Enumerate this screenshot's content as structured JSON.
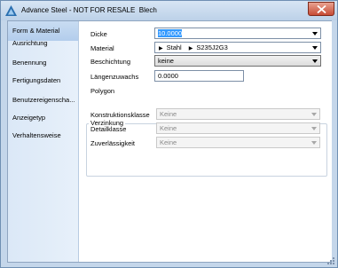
{
  "window": {
    "title": "Advance Steel - NOT FOR RESALE  Blech"
  },
  "sidebar": {
    "items": [
      {
        "label": "Form & Material"
      },
      {
        "label": "Ausrichtung"
      },
      {
        "label": "Benennung"
      },
      {
        "label": "Fertigungsdaten"
      },
      {
        "label": "Benutzereigenscha..."
      },
      {
        "label": "Anzeigetyp"
      },
      {
        "label": "Verhaltensweise"
      }
    ]
  },
  "form": {
    "dicke": {
      "label": "Dicke",
      "value": "10.0000"
    },
    "material": {
      "label": "Material",
      "group": "Stahl",
      "value": "S235J2G3"
    },
    "beschichtung": {
      "label": "Beschichtung",
      "value": "keine"
    },
    "laengenzuwachs": {
      "label": "Längenzuwachs",
      "value": "0.0000"
    },
    "polygon": {
      "label": "Polygon"
    }
  },
  "verzinkung": {
    "title": "Verzinkung",
    "konstruktionsklasse": {
      "label": "Konstruktionsklasse",
      "value": "Keine"
    },
    "detailklasse": {
      "label": "Detailklasse",
      "value": "Keine"
    },
    "zuverlaessigkeit": {
      "label": "Zuverlässigkeit",
      "value": "Keine"
    }
  },
  "colors": {
    "selection": "#3399ff",
    "sidebar_active": "#b3cdec",
    "close": "#c74b35"
  }
}
